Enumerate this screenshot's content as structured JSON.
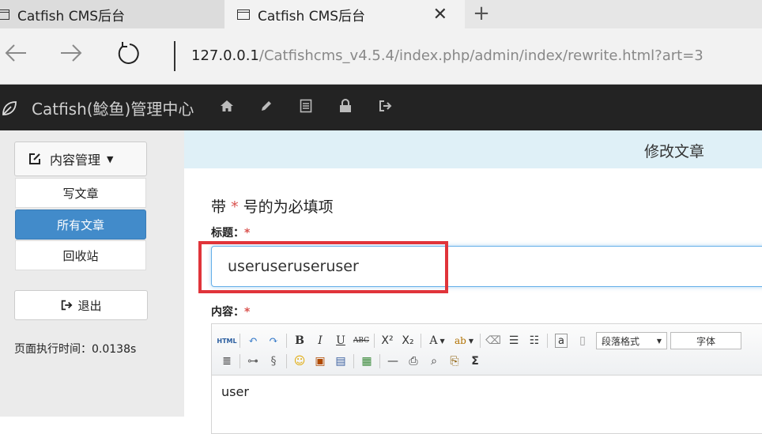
{
  "browser": {
    "tabs": [
      {
        "label": "Catfish CMS后台",
        "active": false
      },
      {
        "label": "Catfish CMS后台",
        "active": true
      }
    ],
    "close_glyph": "✕",
    "new_tab_glyph": "+",
    "url_host": "127.0.0.1",
    "url_path": "/Catfishcms_v4.5.4/index.php/admin/index/rewrite.html?art=3"
  },
  "topnav": {
    "brand": "Catfish(鲶鱼)管理中心",
    "icons": [
      "home-icon",
      "pencil-icon",
      "list-icon",
      "lock-icon",
      "logout-icon"
    ]
  },
  "sidebar": {
    "content_mgmt": "内容管理",
    "items": [
      {
        "label": "写文章",
        "active": false
      },
      {
        "label": "所有文章",
        "active": true
      },
      {
        "label": "回收站",
        "active": false
      }
    ],
    "logout": "退出",
    "exec_time": "页面执行时间：0.0138s"
  },
  "main": {
    "header_title": "修改文章",
    "required_note_prefix": "带",
    "required_star": "*",
    "required_note_suffix": "号的为必填项",
    "title_label": "标题：",
    "title_value": "useruseruseruser",
    "content_label": "内容：",
    "editor": {
      "paragraph_format": "段落格式",
      "font": "字体",
      "body_text": "user"
    }
  },
  "colors": {
    "accent": "#428bca",
    "highlight": "#e0343a",
    "nav_bg": "#232323",
    "header_bg": "#dff0f7"
  }
}
